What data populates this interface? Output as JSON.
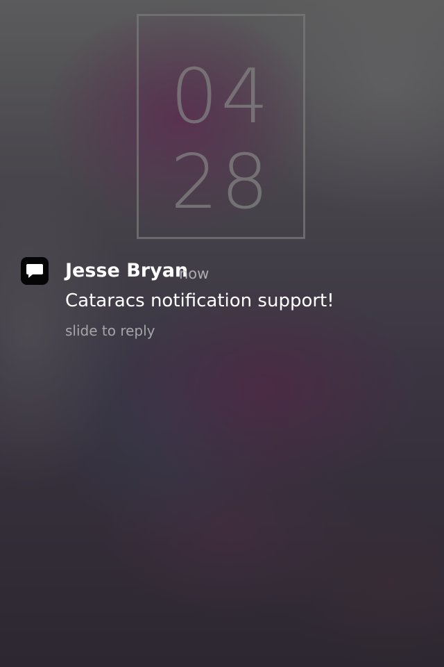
{
  "lockscreen": {
    "clock": {
      "hours": "04",
      "minutes": "28"
    }
  },
  "notification": {
    "app_icon": "message-bubble-icon",
    "sender": "Jesse Bryan",
    "time": "now",
    "message": "Cataracs notification support!",
    "action_hint": "slide to reply"
  },
  "colors": {
    "icon_background": "#050505",
    "text_primary": "#ffffff",
    "clock_frame": "#787878"
  }
}
